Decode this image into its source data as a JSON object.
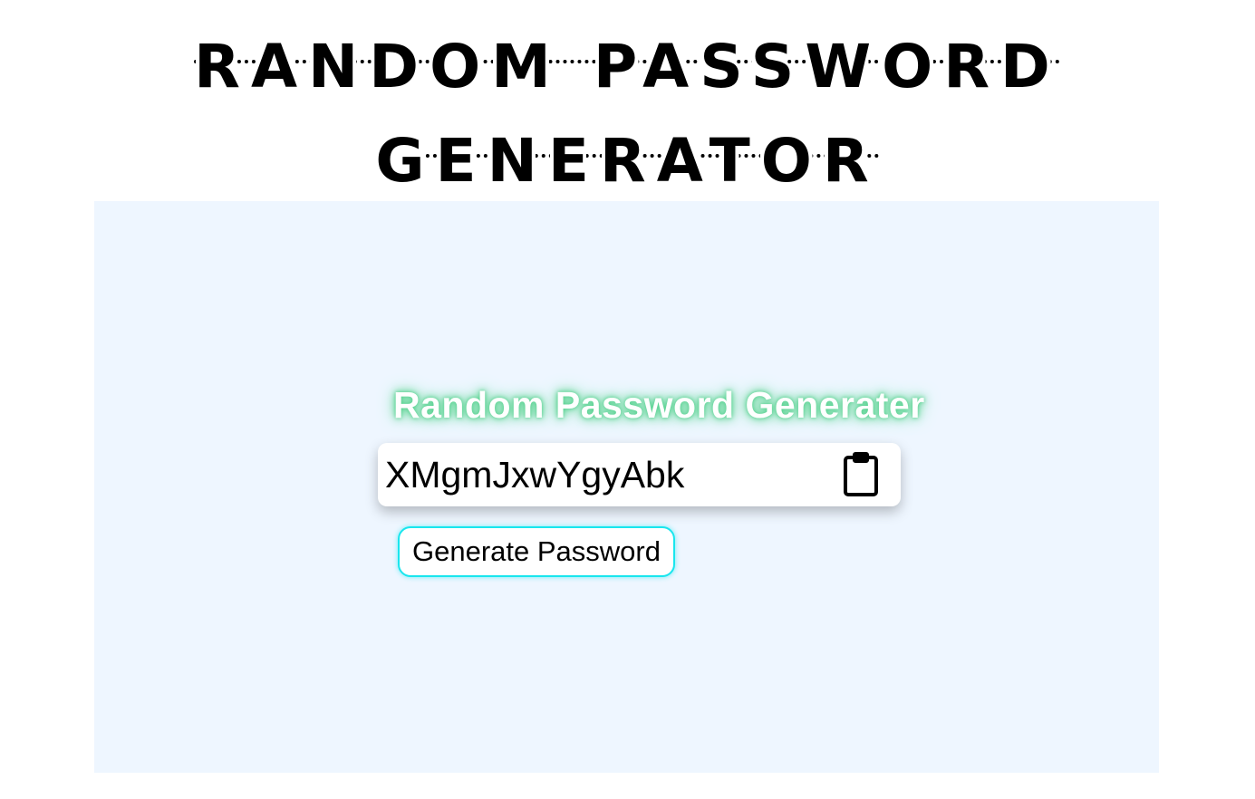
{
  "header": {
    "title": "Random Password Generator"
  },
  "generator": {
    "heading": "Random Password Generater",
    "password_value": "XMgmJxwYgyAbk",
    "copy_icon": "clipboard-icon",
    "generate_label": "Generate Password"
  },
  "colors": {
    "panel_background": "#eef6ff",
    "heading_glow": "#4fd08a",
    "button_border": "#19e6ee"
  }
}
